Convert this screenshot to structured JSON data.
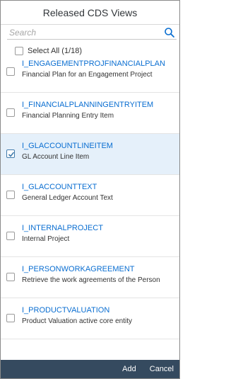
{
  "dialog": {
    "title": "Released CDS Views"
  },
  "search": {
    "placeholder": "Search",
    "value": ""
  },
  "select_all": {
    "label": "Select All (1/18)",
    "checked": false
  },
  "items": [
    {
      "title": "I_ENGAGEMENTPROJFINANCIALPLAN",
      "description": "Financial Plan for an Engagement Project",
      "checked": false
    },
    {
      "title": "I_FINANCIALPLANNINGENTRYITEM",
      "description": "Financial Planning Entry Item",
      "checked": false
    },
    {
      "title": "I_GLACCOUNTLINEITEM",
      "description": "GL Account Line Item",
      "checked": true
    },
    {
      "title": "I_GLACCOUNTTEXT",
      "description": "General Ledger Account Text",
      "checked": false
    },
    {
      "title": "I_INTERNALPROJECT",
      "description": "Internal Project",
      "checked": false
    },
    {
      "title": "I_PERSONWORKAGREEMENT",
      "description": "Retrieve the work agreements of the Person",
      "checked": false
    },
    {
      "title": "I_PRODUCTVALUATION",
      "description": "Product Valuation active core entity",
      "checked": false
    }
  ],
  "footer": {
    "add_label": "Add",
    "cancel_label": "Cancel"
  },
  "colors": {
    "link": "#0a6ed1",
    "selected_row": "#e5f0fa",
    "footer_bg": "#354a5f",
    "checkmark": "#427cac"
  },
  "icons": {
    "search": "search-icon",
    "checkbox": "checkbox-icon",
    "check": "check-icon"
  }
}
